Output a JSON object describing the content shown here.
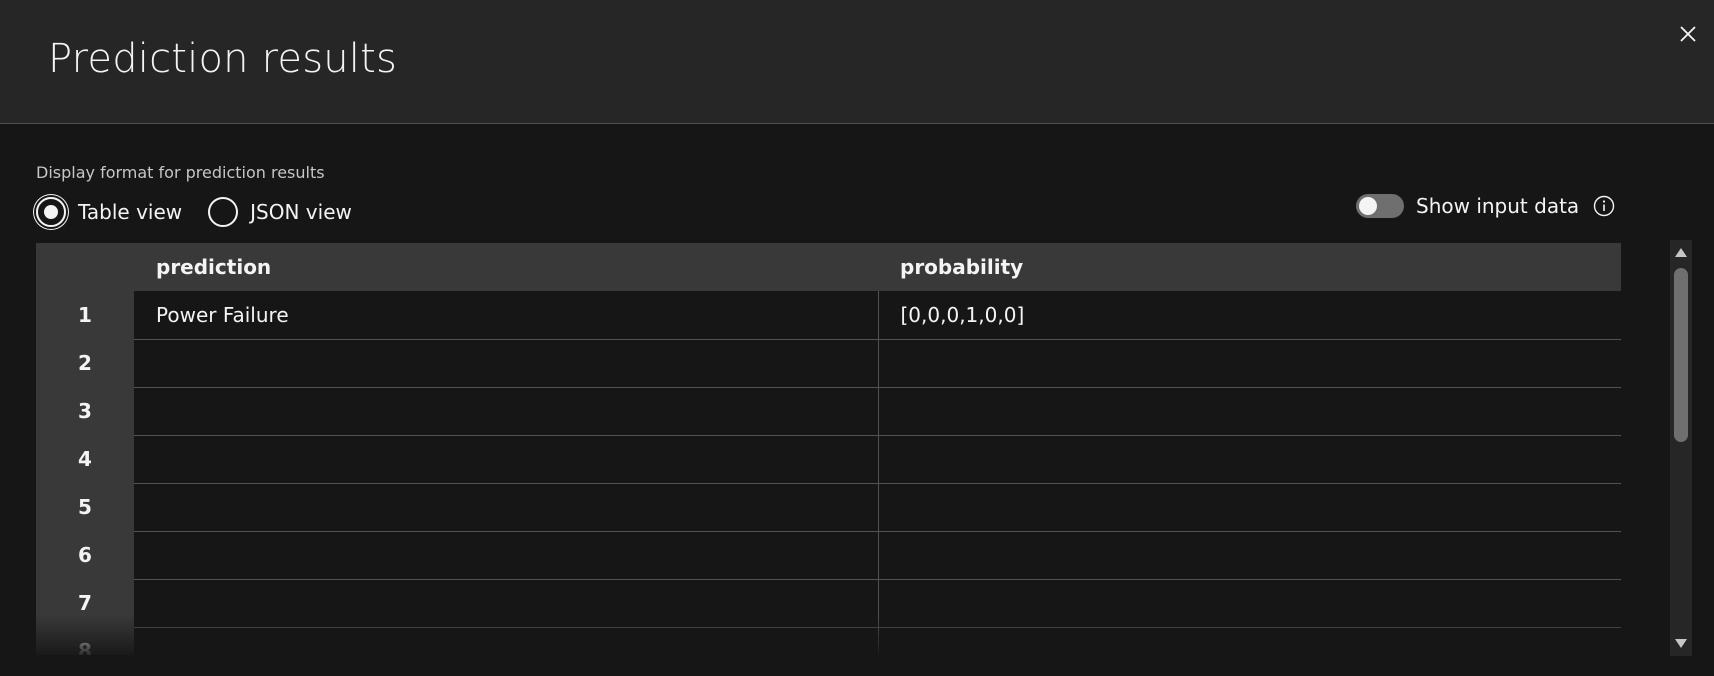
{
  "modal": {
    "title": "Prediction results"
  },
  "format": {
    "label": "Display format for prediction results",
    "options": [
      {
        "label": "Table view",
        "checked": true
      },
      {
        "label": "JSON view",
        "checked": false
      }
    ]
  },
  "toggle": {
    "label": "Show input data",
    "on": false
  },
  "table": {
    "columns": [
      "prediction",
      "probability"
    ],
    "rows": [
      {
        "index": "1",
        "prediction": "Power Failure",
        "probability": "[0,0,0,1,0,0]"
      },
      {
        "index": "2",
        "prediction": "",
        "probability": ""
      },
      {
        "index": "3",
        "prediction": "",
        "probability": ""
      },
      {
        "index": "4",
        "prediction": "",
        "probability": ""
      },
      {
        "index": "5",
        "prediction": "",
        "probability": ""
      },
      {
        "index": "6",
        "prediction": "",
        "probability": ""
      },
      {
        "index": "7",
        "prediction": "",
        "probability": ""
      },
      {
        "index": "8",
        "prediction": "",
        "probability": ""
      }
    ]
  },
  "icons": {
    "close": "close-icon",
    "info": "information-icon",
    "scroll_up": "caret-up-icon",
    "scroll_down": "caret-down-icon"
  }
}
